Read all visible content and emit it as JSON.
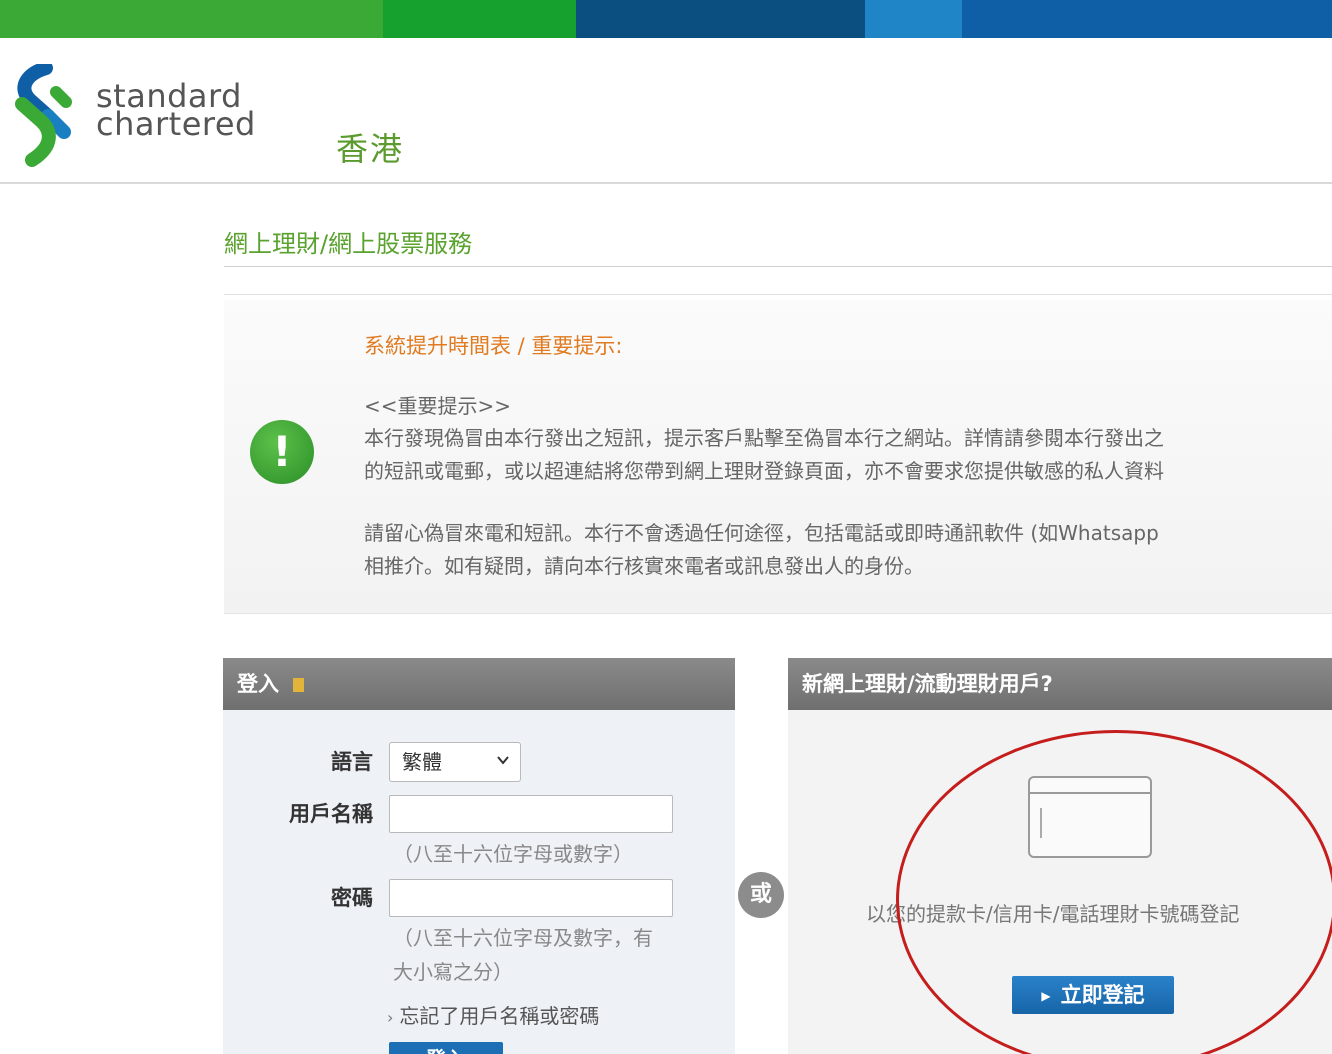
{
  "header": {
    "brand_line1": "standard",
    "brand_line2": "chartered",
    "region": "香港"
  },
  "page": {
    "title": "網上理財/網上股票服務"
  },
  "notice": {
    "heading": "系統提升時間表 / 重要提示:",
    "lines": [
      "<<重要提示>>",
      "本行發現偽冒由本行發出之短訊，提示客戶點擊至偽冒本行之網站。詳情請參閱本行發出之",
      "的短訊或電郵，或以超連結將您帶到網上理財登錄頁面，亦不會要求您提供敏感的私人資料",
      "請留心偽冒來電和短訊。本行不會透過任何途徑，包括電話或即時通訊軟件 (如Whatsapp",
      "相推介。如有疑問，請向本行核實來電者或訊息發出人的身份。"
    ]
  },
  "login": {
    "panel_title": "登入",
    "language_label": "語言",
    "language_value": "繁體",
    "username_label": "用戶名稱",
    "username_hint": "（八至十六位字母或數字）",
    "password_label": "密碼",
    "password_hint_line1": "（八至十六位字母及數字，有",
    "password_hint_line2": "大小寫之分）",
    "forgot_link": "忘記了用戶名稱或密碼",
    "login_button": "登入"
  },
  "or_label": "或",
  "register": {
    "panel_title": "新網上理財/流動理財用戶?",
    "description": "以您的提款卡/信用卡/電話理財卡號碼登記",
    "register_button": "立即登記"
  },
  "colors": {
    "brand_green": "#3aa935",
    "brand_blue": "#0a4f80",
    "accent_orange": "#e07b22",
    "button_blue": "#1c6fb4",
    "annotation_red": "#c51c1c"
  }
}
